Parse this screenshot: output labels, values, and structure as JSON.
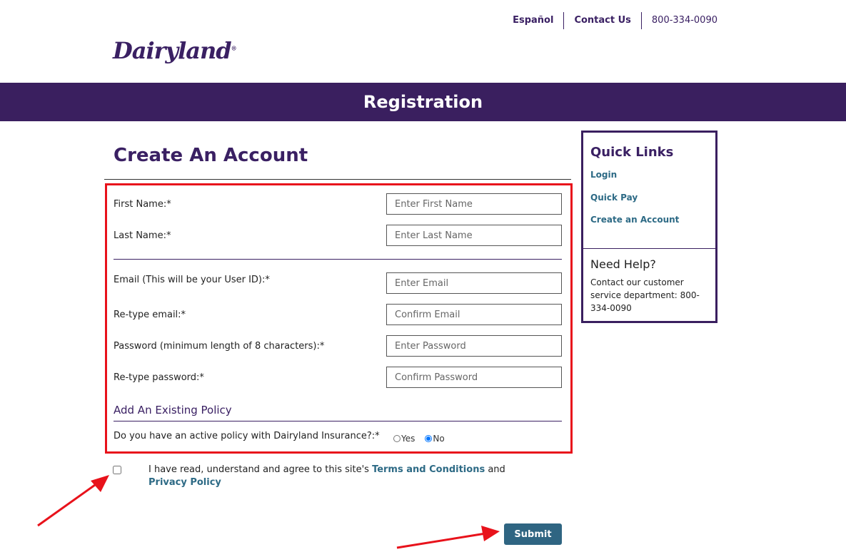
{
  "header": {
    "nav": [
      "Español",
      "Contact Us"
    ],
    "phone": "800-334-0090",
    "logo": "Dairyland",
    "logo_mark": "®",
    "banner": "Registration"
  },
  "form": {
    "title": "Create An Account",
    "fields": [
      {
        "label": "First Name:*",
        "placeholder": "Enter First Name"
      },
      {
        "label": "Last Name:*",
        "placeholder": "Enter Last Name"
      },
      {
        "label": "Email (This will be your User ID):*",
        "placeholder": "Enter Email"
      },
      {
        "label": "Re-type email:*",
        "placeholder": "Confirm Email"
      },
      {
        "label": "Password (minimum length of 8 characters):*",
        "placeholder": "Enter Password"
      },
      {
        "label": "Re-type password:*",
        "placeholder": "Confirm Password"
      }
    ],
    "policy_section": "Add An Existing Policy",
    "policy_question": "Do you have an active policy with Dairyland Insurance?:*",
    "policy_options": [
      "Yes",
      "No"
    ],
    "policy_selected": "No",
    "agree_text": "I have read, understand and agree to this site's ",
    "terms_link": "Terms and Conditions",
    "and_text": " and ",
    "privacy_link": "Privacy Policy",
    "agree_checked": false,
    "submit": "Submit"
  },
  "sidebar": {
    "title": "Quick Links",
    "links": [
      "Login",
      "Quick Pay",
      "Create an Account"
    ],
    "help_title": "Need Help?",
    "help_text": "Contact our customer service department: 800-334-0090"
  },
  "colors": {
    "brand_purple": "#3a1f5f",
    "link_teal": "#2d6a85",
    "highlight_red": "#e8121b"
  }
}
